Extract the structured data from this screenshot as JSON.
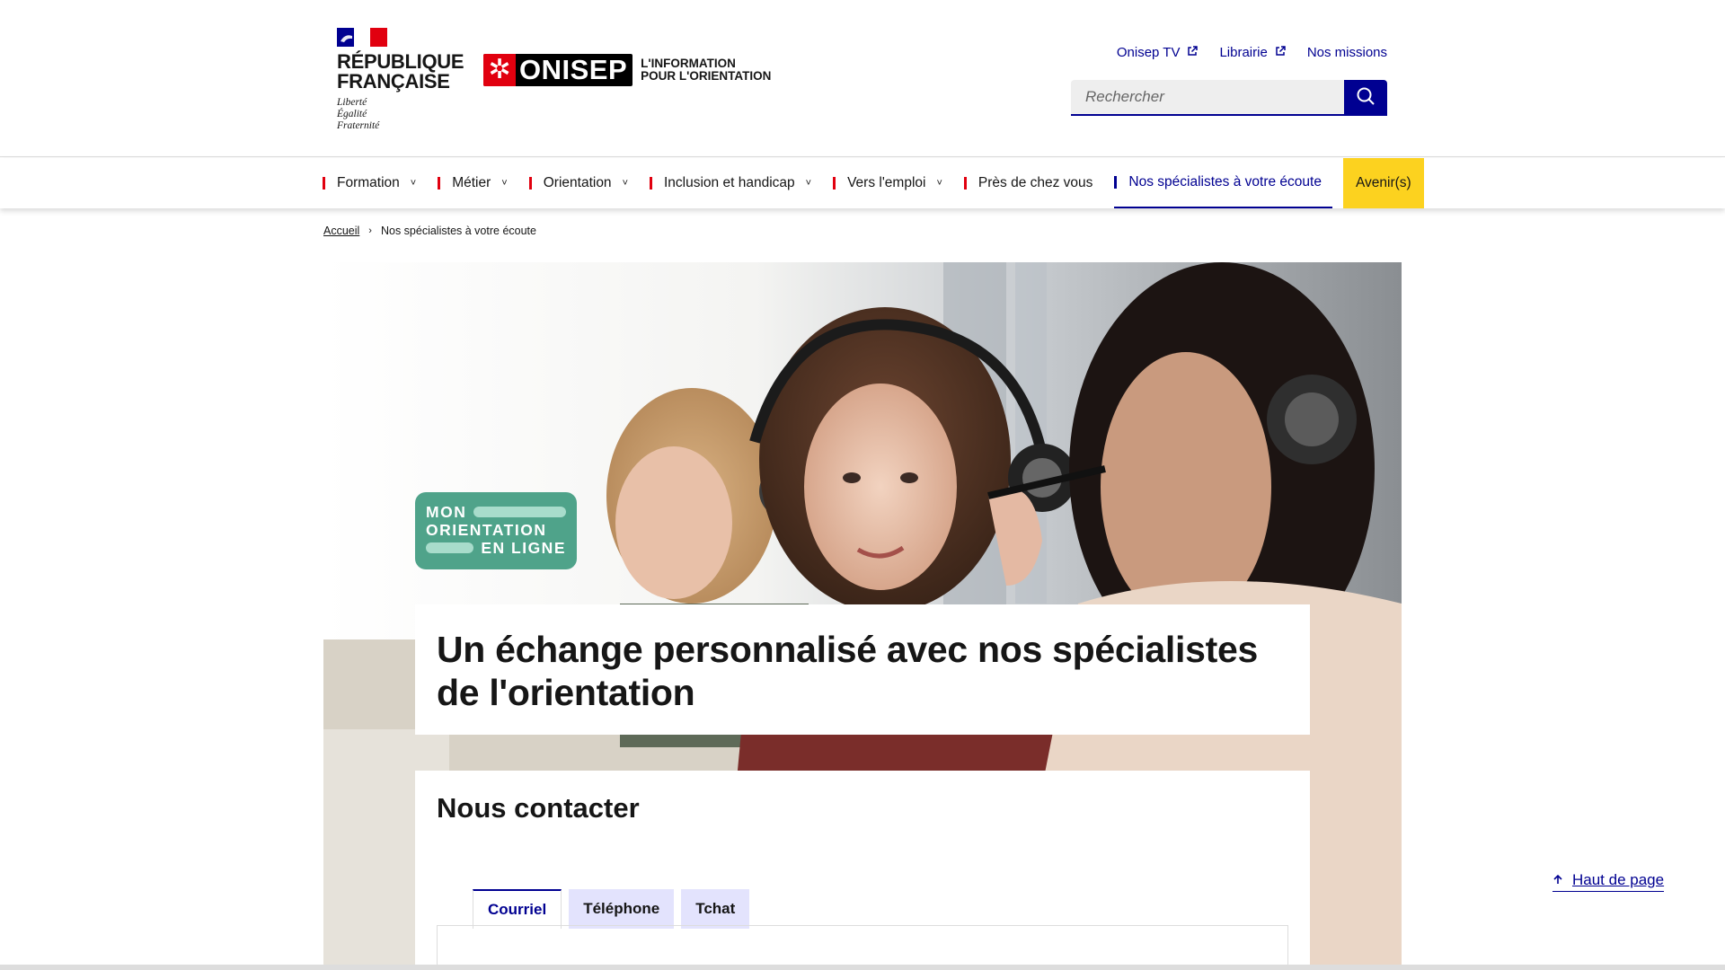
{
  "header": {
    "republic": {
      "line1": "RÉPUBLIQUE",
      "line2": "FRANÇAISE",
      "motto1": "Liberté",
      "motto2": "Égalité",
      "motto3": "Fraternité"
    },
    "brand": {
      "name": "ONISEP",
      "tagline1": "L'INFORMATION",
      "tagline2": "POUR L'ORIENTATION"
    },
    "top_links": [
      {
        "label": "Onisep TV",
        "icon": "external-link-icon"
      },
      {
        "label": "Librairie",
        "icon": "external-link-icon"
      },
      {
        "label": "Nos missions"
      }
    ],
    "search": {
      "placeholder": "Rechercher",
      "button_icon": "search-icon"
    }
  },
  "nav": {
    "items": [
      {
        "label": "Formation",
        "dropdown": true
      },
      {
        "label": "Métier",
        "dropdown": true
      },
      {
        "label": "Orientation",
        "dropdown": true
      },
      {
        "label": "Inclusion et handicap",
        "dropdown": true
      },
      {
        "label": "Vers l'emploi",
        "dropdown": true
      },
      {
        "label": "Près de chez vous",
        "dropdown": false
      },
      {
        "label": "Nos spécialistes à votre écoute",
        "active": true
      },
      {
        "label": "Avenir(s)",
        "highlight": true
      }
    ]
  },
  "breadcrumb": {
    "home": "Accueil",
    "current": "Nos spécialistes à votre écoute"
  },
  "hero": {
    "badge": {
      "line1": "MON",
      "line2": "ORIENTATION",
      "line3": "EN LIGNE"
    },
    "title": "Un échange personnalisé avec nos spécialistes de l'orientation"
  },
  "contact": {
    "heading": "Nous contacter",
    "tabs": [
      {
        "label": "Courriel",
        "selected": true
      },
      {
        "label": "Téléphone"
      },
      {
        "label": "Tchat"
      }
    ]
  },
  "back_to_top": "Haut de page",
  "colors": {
    "blue_france": "#000091",
    "red_marianne": "#e1000f",
    "avenir_yellow": "#fcd21f",
    "badge_green": "#4fa38a"
  }
}
